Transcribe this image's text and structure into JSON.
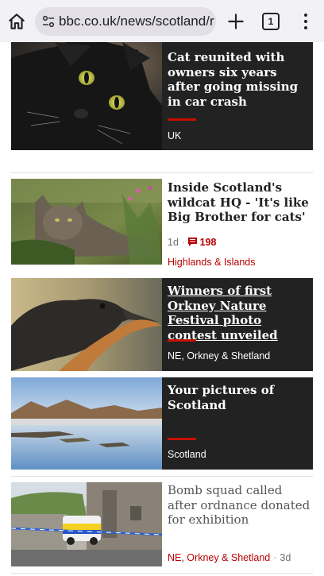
{
  "browser": {
    "url": "bbc.co.uk/news/scotland/r",
    "tab_count": "1"
  },
  "articles": [
    {
      "title": "Cat reunited with owners six years after going missing in car crash",
      "tag": "UK"
    },
    {
      "title": "Inside Scotland's wildcat HQ - 'It's like Big Brother for cats'",
      "time": "1d",
      "comments": "198",
      "tag": "Highlands & Islands"
    },
    {
      "title": "Winners of first Orkney Nature Festival photo contest unveiled",
      "tag": "NE, Orkney & Shetland"
    },
    {
      "title": "Your pictures of Scotland",
      "tag": "Scotland"
    },
    {
      "title": "Bomb squad called after ordnance donated for exhibition",
      "tag": "NE, Orkney & Shetland",
      "time": "3d"
    }
  ],
  "colors": {
    "bbc_red": "#b80000",
    "dark_card": "#222222",
    "toolbar_bg": "#f2f1f6"
  }
}
